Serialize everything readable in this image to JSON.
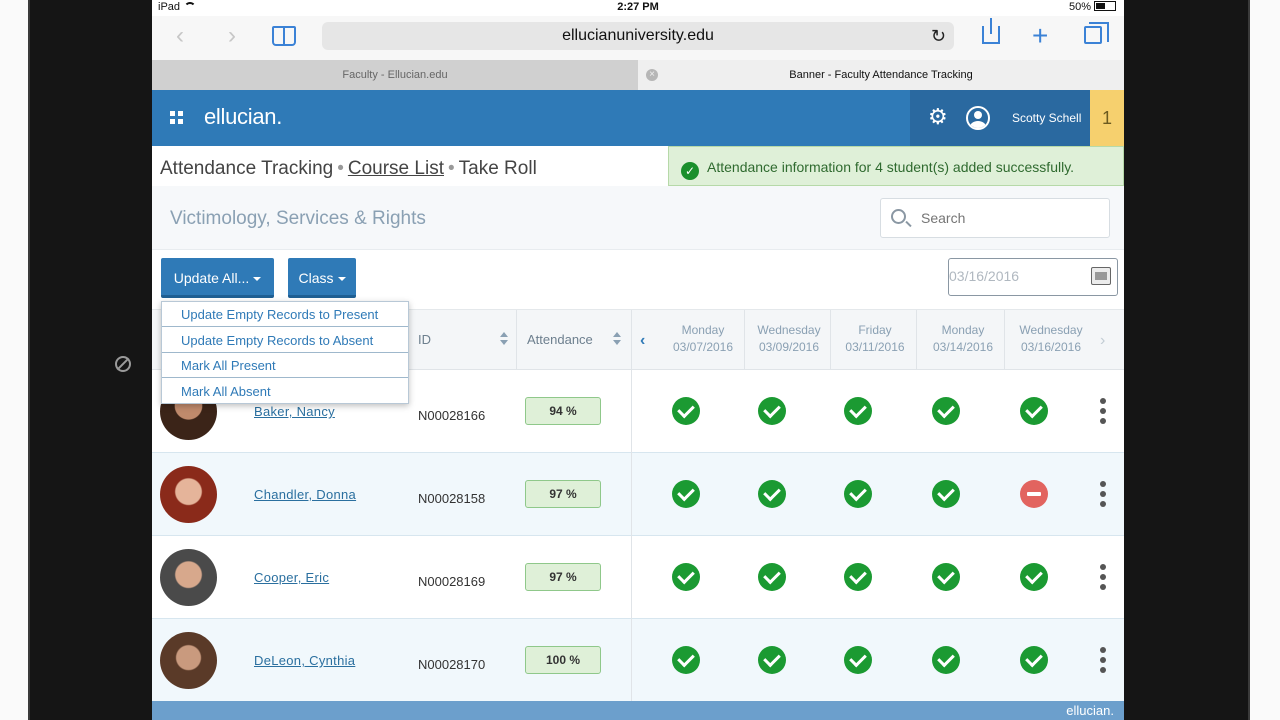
{
  "status_bar": {
    "device": "iPad",
    "time": "2:27 PM",
    "battery": "50%"
  },
  "browser": {
    "url": "ellucianuniversity.edu",
    "tabs": [
      {
        "label": "Faculty - Ellucian.edu"
      },
      {
        "label": "Banner - Faculty Attendance Tracking"
      }
    ]
  },
  "header": {
    "brand": "ellucian.",
    "user_name": "Scotty Schell",
    "notifications": "1"
  },
  "breadcrumb": {
    "root": "Attendance Tracking",
    "middle": "Course List",
    "current": "Take Roll"
  },
  "toast": {
    "message": "Attendance information for 4 student(s) added successfully."
  },
  "course": {
    "title": "Victimology, Services & Rights"
  },
  "search": {
    "placeholder": "Search"
  },
  "toolbar": {
    "update_all_label": "Update All...",
    "class_label": "Class",
    "date_value": "03/16/2016"
  },
  "menu": {
    "items": [
      "Update Empty Records to Present",
      "Update Empty Records to Absent",
      "Mark All Present",
      "Mark All Absent"
    ]
  },
  "table": {
    "columns": {
      "id": "ID",
      "attendance": "Attendance"
    },
    "dates": [
      {
        "day": "Monday",
        "date": "03/07/2016"
      },
      {
        "day": "Wednesday",
        "date": "03/09/2016"
      },
      {
        "day": "Friday",
        "date": "03/11/2016"
      },
      {
        "day": "Monday",
        "date": "03/14/2016"
      },
      {
        "day": "Wednesday",
        "date": "03/16/2016"
      }
    ],
    "rows": [
      {
        "name": "Baker, Nancy",
        "id": "N00028166",
        "attendance": "94 %",
        "marks": [
          "present",
          "present",
          "present",
          "present",
          "present"
        ]
      },
      {
        "name": "Chandler, Donna",
        "id": "N00028158",
        "attendance": "97 %",
        "marks": [
          "present",
          "present",
          "present",
          "present",
          "absent"
        ]
      },
      {
        "name": "Cooper, Eric",
        "id": "N00028169",
        "attendance": "97 %",
        "marks": [
          "present",
          "present",
          "present",
          "present",
          "present"
        ]
      },
      {
        "name": "DeLeon, Cynthia",
        "id": "N00028170",
        "attendance": "100 %",
        "marks": [
          "present",
          "present",
          "present",
          "present",
          "present"
        ]
      }
    ]
  },
  "colors": {
    "brand_blue": "#2f7ab7",
    "present_green": "#1b9a32",
    "absent_red": "#e2645f",
    "badge_yellow": "#f6d06e"
  },
  "footer": {
    "brand": "ellucian."
  }
}
